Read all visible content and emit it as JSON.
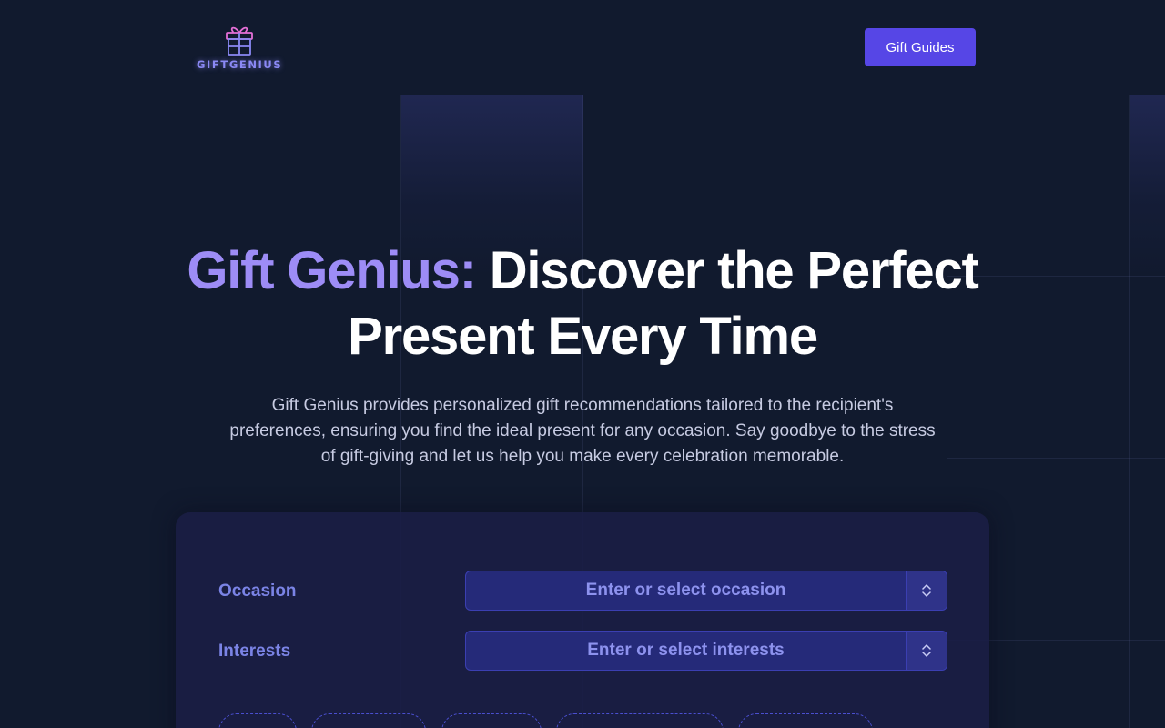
{
  "header": {
    "logo_text": "GIFTGENIUS",
    "nav_button_label": "Gift Guides"
  },
  "hero": {
    "title_accent": "Gift Genius:",
    "title_rest": " Discover the Perfect Present Every Time",
    "subtitle": "Gift Genius provides personalized gift recommendations tailored to the recipient's preferences, ensuring you find the ideal present for any occasion. Say goodbye to the stress of gift-giving and let us help you make every celebration memorable."
  },
  "form": {
    "occasion": {
      "label": "Occasion",
      "value": "",
      "placeholder": "Enter or select occasion"
    },
    "interests": {
      "label": "Interests",
      "value": "",
      "placeholder": "Enter or select interests"
    },
    "chips": [
      "",
      "",
      "",
      "",
      ""
    ]
  },
  "colors": {
    "background": "#111a2e",
    "accent": "#5646e6",
    "title_accent": "#9d8cf6",
    "label": "#7b84e6"
  },
  "icons": {
    "logo": "gift-box-icon",
    "combo_toggle": "chevron-up-down-icon"
  }
}
